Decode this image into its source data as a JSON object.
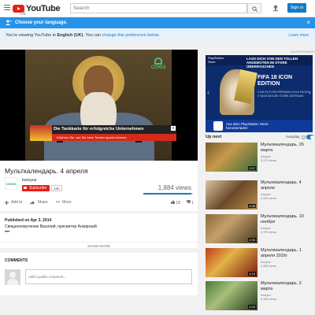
{
  "masthead": {
    "logo_text": "YouTube",
    "country": "DE",
    "search_placeholder": "Search",
    "signin_label": "Sign in"
  },
  "language_bar": {
    "title": "Choose your language.",
    "close": "×",
    "message_prefix": "You're viewing YouTube in ",
    "language": "English (UK)",
    "message_mid": ". You can ",
    "change_link": "change this preference below",
    "learn_more": "Learn more"
  },
  "player": {
    "channel_watermark": "СОЮЗ",
    "ad_line1": "Die Tankkarte für erfolgreiche Unternehmen",
    "ad_line2": "Erfahren Sie, wie Sie beim Tanken sparen können",
    "ad_close": "x"
  },
  "video": {
    "title": "Мульткалендарь. 4 апреля",
    "channel": "tvsoyuz",
    "channel_avatar": "СОЮЗ",
    "subscribe_label": "Subscribe",
    "subscriber_count": "13K",
    "views": "1,884 views",
    "like_ratio": 0.97,
    "actions": [
      "Add to",
      "Share",
      "More"
    ],
    "likes": "18",
    "dislikes": "1"
  },
  "description": {
    "published": "Published on Apr 3, 2014",
    "text": "Священномученик Василий, пресвитер Анкирский",
    "ellipsis": "•••",
    "show_more": "SHOW MORE"
  },
  "comments": {
    "header": "COMMENTS",
    "input_placeholder": "Add a public comment..."
  },
  "ad": {
    "label": "ADVERTISEMENT",
    "brand_line1": "PlayStation",
    "brand_line2": "Store",
    "headline": "LASS DICH VON DEN TOLLEN ANGEBOTEN IM STORE ÜBERRASCHEN",
    "product": "FIFA 18 ICON EDITION",
    "promo_1": "3.300 FUT-FIFA PREMIUM GOLD PACKS",
    "promo_2": "3 TAGE WOCHE STORE ZEITRAUM",
    "cta_line1": "Aus dem PlayStation Store",
    "cta_line2": "herunterladen"
  },
  "up_next": {
    "title": "Up next",
    "autoplay_label": "Autoplay",
    "autoplay_on": true
  },
  "related": [
    {
      "title": "Мультикалендарь. 26 марта",
      "channel": "tvsoyuz",
      "views": "3,174 views",
      "duration": "2:57"
    },
    {
      "title": "Мультикалендарь. 4 апреле",
      "channel": "tvsoyuz",
      "views": "2,321 views",
      "duration": "2:58"
    },
    {
      "title": "Мультикалендарь. 10 ноября",
      "channel": "tvsoyuz",
      "views": "4,795 views",
      "duration": "2:55"
    },
    {
      "title": "Мультикалендарь. 1 апреля 2016г",
      "channel": "tvsoyuz",
      "views": "2,405 views",
      "duration": "3:16"
    },
    {
      "title": "Мультикалендарь. 2 марта",
      "channel": "tvsoyuz",
      "views": "3,198 views",
      "duration": "2:53"
    }
  ]
}
